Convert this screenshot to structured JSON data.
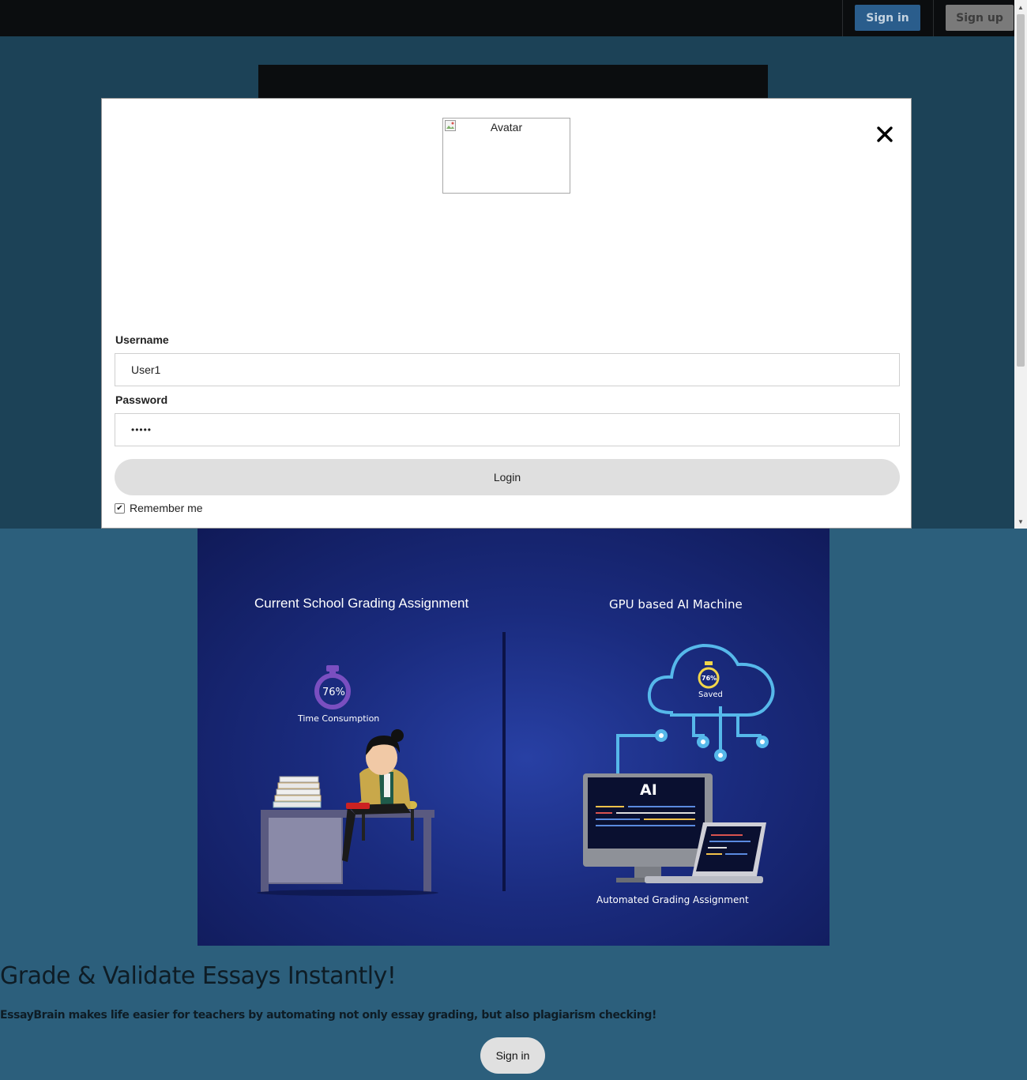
{
  "nav": {
    "signin_label": "Sign in",
    "signup_label": "Sign up"
  },
  "login_modal": {
    "avatar_alt": "Avatar",
    "close_icon": "close-icon",
    "username_label": "Username",
    "username_value": "User1",
    "password_label": "Password",
    "password_value": "•••••",
    "login_label": "Login",
    "remember_label": "Remember me",
    "remember_checked": true
  },
  "hero_image": {
    "left_title": "Current School Grading Assignment",
    "right_title": "GPU based AI Machine",
    "left_percent": "76%",
    "left_caption": "Time Consumption",
    "right_percent": "76%",
    "right_caption": "Saved",
    "screen_label": "AI",
    "bottom_caption": "Automated Grading Assignment"
  },
  "main": {
    "headline": "Grade & Validate Essays Instantly!",
    "subtext": "EssayBrain makes life easier for teachers by automating not only essay grading, but also plagiarism checking!",
    "cta_label": "Sign in"
  },
  "colors": {
    "page_bg": "#2c5f7c",
    "overlay_bg": "#1c4257",
    "navbar_bg": "#0b0d0f",
    "signin_button": "#2a5d8c",
    "signup_button": "#7a7a7a"
  }
}
